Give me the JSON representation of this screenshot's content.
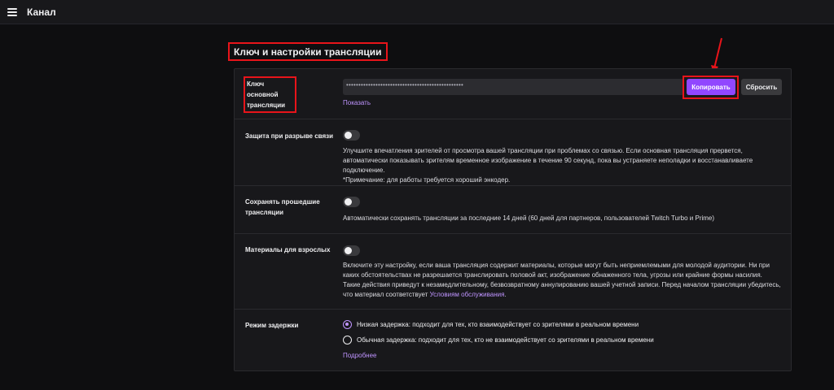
{
  "header": {
    "title": "Канал"
  },
  "section": {
    "title": "Ключ и настройки трансляции"
  },
  "stream_key": {
    "label": "Ключ основной трансляции",
    "masked_value": "••••••••••••••••••••••••••••••••••••••••••••••••",
    "copy_label": "Копировать",
    "reset_label": "Сбросить",
    "show_label": "Показать"
  },
  "disconnect_protection": {
    "label": "Защита при разрыве связи",
    "enabled": false,
    "description": "Улучшите впечатления зрителей от просмотра вашей трансляции при проблемах со связью. Если основная трансляция прервется, автоматически показывать зрителям временное изображение в течение 90 секунд, пока вы устраняете неполадки и восстанавливаете подключение.",
    "note": "*Примечание: для работы требуется хороший энкодер."
  },
  "save_past": {
    "label": "Сохранять прошедшие трансляции",
    "enabled": false,
    "description": "Автоматически сохранять трансляции за последние 14 дней (60 дней для партнеров, пользователей Twitch Turbo и Prime)"
  },
  "mature": {
    "label": "Материалы для взрослых",
    "enabled": false,
    "description": "Включите эту настройку, если ваша трансляция содержит материалы, которые могут быть неприемлемыми для молодой аудитории. Ни при каких обстоятельствах не разрешается транслировать половой акт, изображение обнаженного тела, угрозы или крайние формы насилия. Такие действия приведут к незамедлительному, безвозвратному аннулированию вашей учетной записи. Перед началом трансляции убедитесь, что материал соответствует",
    "terms_link": "Условиям обслуживания",
    "terms_suffix": "."
  },
  "latency": {
    "label": "Режим задержки",
    "options": [
      {
        "label": "Низкая задержка: подходит для тех, кто взаимодействует со зрителями в реальном времени",
        "selected": true
      },
      {
        "label": "Обычная задержка: подходит для тех, кто не взаимодействует со зрителями в реальном времени",
        "selected": false
      }
    ],
    "more_link": "Подробнее"
  },
  "colors": {
    "accent": "#9147ff",
    "link": "#bf94ff",
    "highlight": "#e8141a",
    "background": "#0e0e10",
    "panel": "#18181b"
  }
}
